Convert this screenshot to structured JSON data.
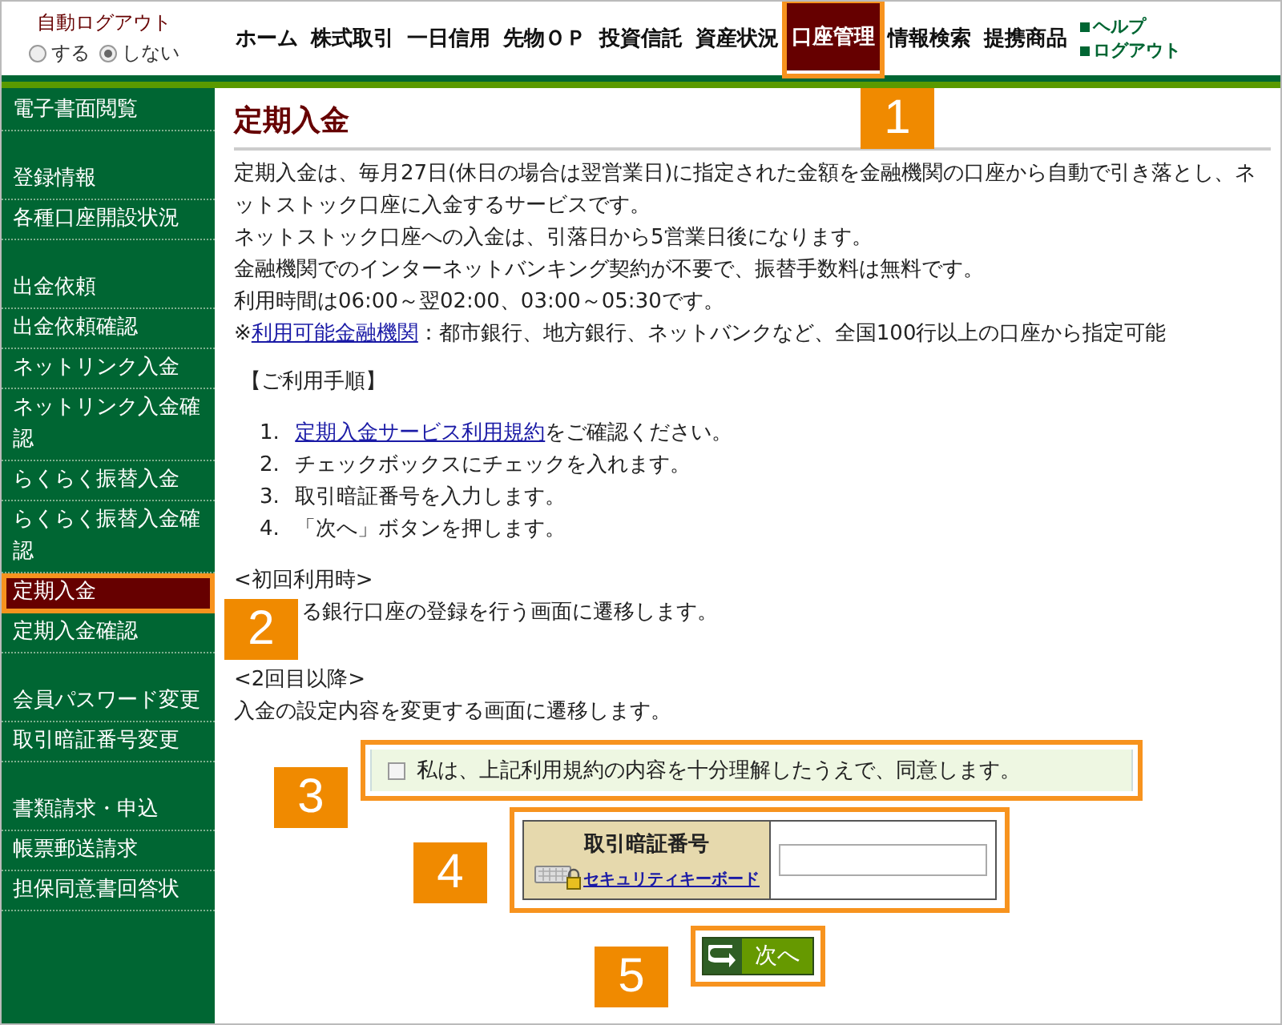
{
  "auto_logout": {
    "label": "自動ログアウト",
    "options": [
      {
        "label": "する",
        "selected": false
      },
      {
        "label": "しない",
        "selected": true
      }
    ]
  },
  "nav": {
    "items": [
      {
        "label": "ホーム",
        "selected": false,
        "highlighted": false
      },
      {
        "label": "株式取引",
        "selected": false,
        "highlighted": false
      },
      {
        "label": "一日信用",
        "selected": false,
        "highlighted": false
      },
      {
        "label": "先物ＯＰ",
        "selected": false,
        "highlighted": false
      },
      {
        "label": "投資信託",
        "selected": false,
        "highlighted": false
      },
      {
        "label": "資産状況",
        "selected": false,
        "highlighted": false
      },
      {
        "label": "口座管理",
        "selected": true,
        "highlighted": true
      },
      {
        "label": "情報検索",
        "selected": false,
        "highlighted": false
      },
      {
        "label": "提携商品",
        "selected": false,
        "highlighted": false
      }
    ]
  },
  "header_links": [
    "ヘルプ",
    "ログアウト"
  ],
  "sidebar": {
    "groups": [
      {
        "items": [
          {
            "label": "電子書面閲覧",
            "selected": false,
            "highlighted": false
          }
        ]
      },
      {
        "items": [
          {
            "label": "登録情報",
            "selected": false,
            "highlighted": false
          },
          {
            "label": "各種口座開設状況",
            "selected": false,
            "highlighted": false
          }
        ]
      },
      {
        "items": [
          {
            "label": "出金依頼",
            "selected": false,
            "highlighted": false
          },
          {
            "label": "出金依頼確認",
            "selected": false,
            "highlighted": false
          },
          {
            "label": "ネットリンク入金",
            "selected": false,
            "highlighted": false
          },
          {
            "label": "ネットリンク入金確認",
            "selected": false,
            "highlighted": false
          },
          {
            "label": "らくらく振替入金",
            "selected": false,
            "highlighted": false
          },
          {
            "label": "らくらく振替入金確認",
            "selected": false,
            "highlighted": false
          },
          {
            "label": "定期入金",
            "selected": true,
            "highlighted": true
          },
          {
            "label": "定期入金確認",
            "selected": false,
            "highlighted": false
          }
        ]
      },
      {
        "items": [
          {
            "label": "会員パスワード変更",
            "selected": false,
            "highlighted": false
          },
          {
            "label": "取引暗証番号変更",
            "selected": false,
            "highlighted": false
          }
        ]
      },
      {
        "items": [
          {
            "label": "書類請求・申込",
            "selected": false,
            "highlighted": false
          },
          {
            "label": "帳票郵送請求",
            "selected": false,
            "highlighted": false
          },
          {
            "label": "担保同意書回答状",
            "selected": false,
            "highlighted": false
          }
        ]
      }
    ]
  },
  "page_title": "定期入金",
  "intro": [
    "定期入金は、毎月27日(休日の場合は翌営業日)に指定された金額を金融機関の口座から自動で引き落とし、ネットストック口座に入金するサービスです。",
    "ネットストック口座への入金は、引落日から5営業日後になります。",
    "金融機関でのインターネットバンキング契約が不要で、振替手数料は無料です。",
    "利用時間は06:00～翌02:00、03:00～05:30です。"
  ],
  "note": {
    "prefix": "※",
    "link": "利用可能金融機関",
    "text": "：都市銀行、地方銀行、ネットバンクなど、全国100行以上の口座から指定可能"
  },
  "procedure": {
    "heading": "【ご利用手順】",
    "steps": [
      {
        "number": "1.",
        "link": "定期入金サービス利用規約",
        "text": "をご確認ください。"
      },
      {
        "number": "2.",
        "text": "チェックボックスにチェックを入れます。"
      },
      {
        "number": "3.",
        "text": "取引暗証番号を入力します。"
      },
      {
        "number": "4.",
        "text": "「次へ」ボタンを押します。"
      }
    ]
  },
  "first_use": {
    "heading": "<初回利用時>",
    "text": "る銀行口座の登録を行う画面に遷移します。"
  },
  "later_use": {
    "heading": "<2回目以降>",
    "text": "入金の設定内容を変更する画面に遷移します。"
  },
  "agreement": {
    "label": "私は、上記利用規約の内容を十分理解したうえで、同意します。",
    "checked": false,
    "highlighted": true
  },
  "pin": {
    "label": "取引暗証番号",
    "keyboard_link": "セキュリティキーボード",
    "highlighted": true
  },
  "next_button": {
    "label": "次へ",
    "highlighted": true
  },
  "annotations": [
    "1",
    "2",
    "3",
    "4",
    "5"
  ]
}
